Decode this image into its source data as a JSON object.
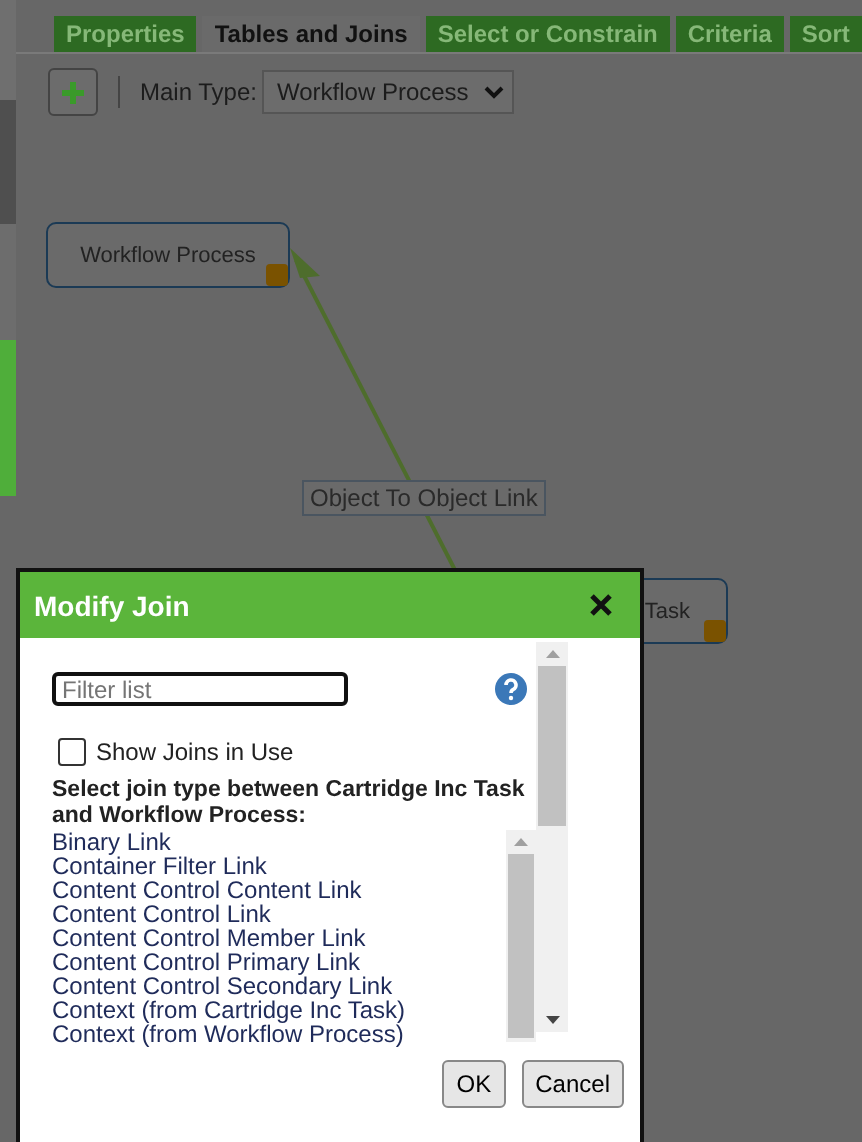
{
  "tabs": [
    {
      "label": "Properties",
      "selected": false
    },
    {
      "label": "Tables and Joins",
      "selected": true
    },
    {
      "label": "Select or Constrain",
      "selected": false
    },
    {
      "label": "Criteria",
      "selected": false
    },
    {
      "label": "Sort",
      "selected": false
    }
  ],
  "toolbar": {
    "main_type_label": "Main Type:",
    "main_type_value": "Workflow Process"
  },
  "canvas": {
    "nodes": [
      "Workflow Process",
      "Task"
    ],
    "link_label": "Object To Object Link"
  },
  "dialog": {
    "title": "Modify Join",
    "filter": {
      "placeholder": "Filter list"
    },
    "show_joins": {
      "label": "Show Joins in Use",
      "checked": false
    },
    "prompt": "Select join type between Cartridge Inc Task and Workflow Process:",
    "options": [
      {
        "label": "Binary Link",
        "selected": false
      },
      {
        "label": "Container Filter Link",
        "selected": false
      },
      {
        "label": "Content Control Content Link",
        "selected": false
      },
      {
        "label": "Content Control Link",
        "selected": false
      },
      {
        "label": "Content Control Member Link",
        "selected": false
      },
      {
        "label": "Content Control Primary Link",
        "selected": false
      },
      {
        "label": "Content Control Secondary Link",
        "selected": false
      },
      {
        "label": "Context (from Cartridge Inc Task)",
        "selected": false
      },
      {
        "label": "Context (from Workflow Process)",
        "selected": false
      }
    ],
    "buttons": [
      "OK",
      "Cancel"
    ]
  }
}
